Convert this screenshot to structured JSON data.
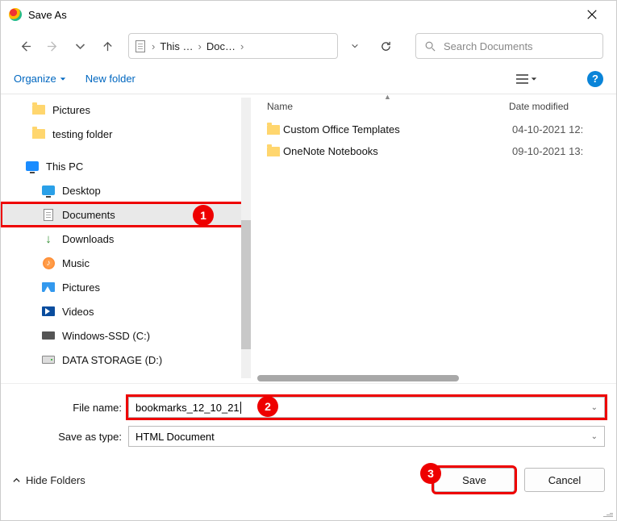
{
  "title": "Save As",
  "breadcrumb": {
    "seg1": "This …",
    "seg2": "Doc…"
  },
  "search_placeholder": "Search Documents",
  "toolbar": {
    "organize": "Organize",
    "newfolder": "New folder"
  },
  "tree": {
    "pictures_qa": "Pictures",
    "testing": "testing folder",
    "thispc": "This PC",
    "desktop": "Desktop",
    "documents": "Documents",
    "downloads": "Downloads",
    "music": "Music",
    "pictures": "Pictures",
    "videos": "Videos",
    "ssd": "Windows-SSD (C:)",
    "data": "DATA STORAGE (D:)"
  },
  "list": {
    "col_name": "Name",
    "col_date": "Date modified",
    "row1": {
      "name": "Custom Office Templates",
      "date": "04-10-2021 12:"
    },
    "row2": {
      "name": "OneNote Notebooks",
      "date": "09-10-2021 13:"
    }
  },
  "fields": {
    "filename_label": "File name:",
    "filename_value": "bookmarks_12_10_21",
    "savetype_label": "Save as type:",
    "savetype_value": "HTML Document"
  },
  "footer": {
    "hide": "Hide Folders",
    "save": "Save",
    "cancel": "Cancel"
  },
  "badges": {
    "b1": "1",
    "b2": "2",
    "b3": "3"
  }
}
